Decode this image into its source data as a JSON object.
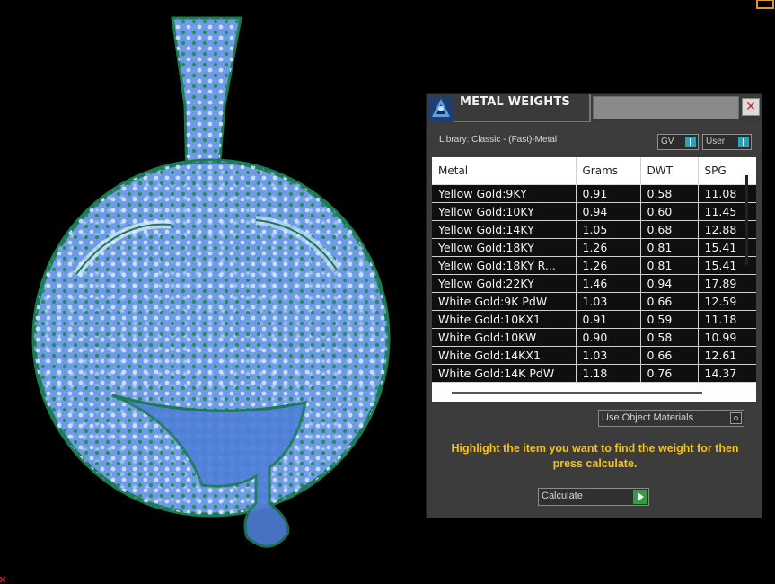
{
  "panel": {
    "title": "METAL WEIGHTS",
    "close_label": "✕",
    "library_label": "Library: Classic - (Fast)-Metal",
    "toggle_gv": "GV",
    "toggle_user": "User",
    "use_object_materials": "Use Object Materials",
    "hint": "Highlight the item you want to find the weight for then press calculate.",
    "calculate_label": "Calculate",
    "accent_color": "#f3c320"
  },
  "table": {
    "columns": [
      "Metal",
      "Grams",
      "DWT",
      "SPG"
    ],
    "rows": [
      [
        "Yellow Gold:9KY",
        "0.91",
        "0.58",
        "11.08"
      ],
      [
        "Yellow Gold:10KY",
        "0.94",
        "0.60",
        "11.45"
      ],
      [
        "Yellow Gold:14KY",
        "1.05",
        "0.68",
        "12.88"
      ],
      [
        "Yellow Gold:18KY",
        "1.26",
        "0.81",
        "15.41"
      ],
      [
        "Yellow Gold:18KY R...",
        "1.26",
        "0.81",
        "15.41"
      ],
      [
        "Yellow Gold:22KY",
        "1.46",
        "0.94",
        "17.89"
      ],
      [
        "White Gold:9K PdW",
        "1.03",
        "0.66",
        "12.59"
      ],
      [
        "White Gold:10KX1",
        "0.91",
        "0.59",
        "11.18"
      ],
      [
        "White Gold:10KW",
        "0.90",
        "0.58",
        "10.99"
      ],
      [
        "White Gold:14KX1",
        "1.03",
        "0.66",
        "12.61"
      ],
      [
        "White Gold:14K PdW",
        "1.18",
        "0.76",
        "14.37"
      ]
    ]
  },
  "viewport": {
    "object": "pendant-model",
    "colors": {
      "fill": "#6f9be6",
      "prongs": "#1d7a56",
      "stones": "#cfe7ff"
    }
  }
}
